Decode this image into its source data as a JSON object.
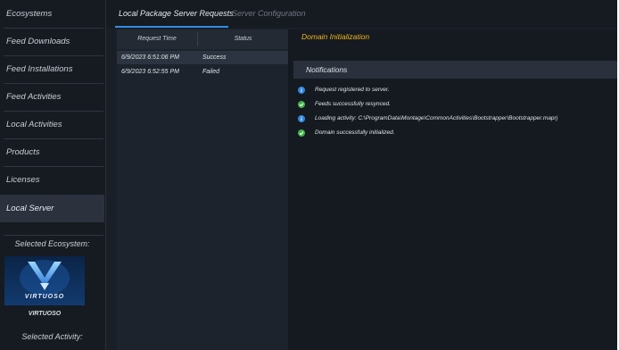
{
  "sidebar": {
    "items": [
      {
        "label": "Ecosystems"
      },
      {
        "label": "Feed Downloads"
      },
      {
        "label": "Feed Installations"
      },
      {
        "label": "Feed Activities"
      },
      {
        "label": "Local Activities"
      },
      {
        "label": "Products"
      },
      {
        "label": "Licenses"
      },
      {
        "label": "Local Server",
        "active": true
      }
    ],
    "selected_ecosystem_label": "Selected Ecosystem:",
    "ecosystem_logo_text": "VIRTUOSO",
    "ecosystem_name": "VIRTUOSO",
    "selected_activity_label": "Selected Activity:"
  },
  "tabs": [
    {
      "label": "Local Package Server Requests",
      "active": true
    },
    {
      "label": "Server Configuration",
      "active": false
    }
  ],
  "requests": {
    "columns": [
      "Request Time",
      "Status"
    ],
    "rows": [
      {
        "time": "6/9/2023 6:51:06 PM",
        "status": "Success",
        "selected": true
      },
      {
        "time": "6/9/2023 6:52:55 PM",
        "status": "Failed",
        "selected": false
      }
    ]
  },
  "detail": {
    "title": "Domain Initialization",
    "notifications_header": "Notifications",
    "notifications": [
      {
        "type": "info",
        "icon": "info-icon",
        "text": "Request registered to server."
      },
      {
        "type": "success",
        "icon": "check-icon",
        "text": "Feeds successfully resynced."
      },
      {
        "type": "info",
        "icon": "info-icon",
        "text": "Loading activity: C:\\ProgramData\\Montage\\CommonActivities\\Bootstrapper\\Bootstrapper.maprj"
      },
      {
        "type": "success",
        "icon": "check-icon",
        "text": "Domain successfully initialized."
      }
    ]
  },
  "colors": {
    "accent": "#2f8de4",
    "title": "#f0b51d",
    "info": "#2f86de",
    "success": "#42b14a"
  }
}
